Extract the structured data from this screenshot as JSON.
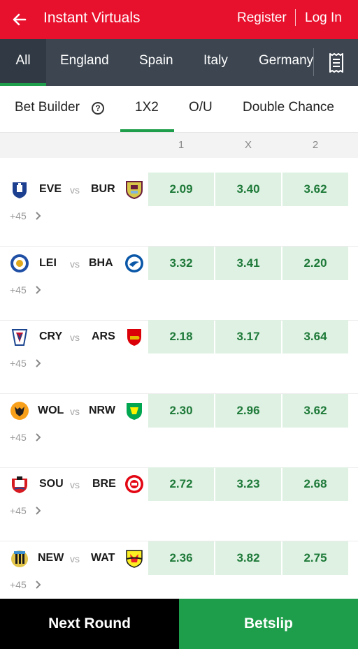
{
  "header": {
    "title": "Instant Virtuals",
    "register_label": "Register",
    "login_label": "Log In",
    "back_icon": "arrow-left-icon",
    "color": "#e8112d"
  },
  "nav": {
    "tabs": [
      "All",
      "England",
      "Spain",
      "Italy",
      "Germany"
    ],
    "active": "All",
    "betslip_icon": "receipt-icon"
  },
  "markets": {
    "bet_builder_label": "Bet Builder",
    "tabs": [
      "1X2",
      "O/U",
      "Double Chance"
    ],
    "active": "1X2"
  },
  "columns": [
    "1",
    "X",
    "2"
  ],
  "matches": [
    {
      "home": "EVE",
      "vs": "vs",
      "away": "BUR",
      "odds": [
        "2.09",
        "3.40",
        "3.62"
      ],
      "more": "+45"
    },
    {
      "home": "LEI",
      "vs": "vs",
      "away": "BHA",
      "odds": [
        "3.32",
        "3.41",
        "2.20"
      ],
      "more": "+45"
    },
    {
      "home": "CRY",
      "vs": "vs",
      "away": "ARS",
      "odds": [
        "2.18",
        "3.17",
        "3.64"
      ],
      "more": "+45"
    },
    {
      "home": "WOL",
      "vs": "vs",
      "away": "NRW",
      "odds": [
        "2.30",
        "2.96",
        "3.62"
      ],
      "more": "+45"
    },
    {
      "home": "SOU",
      "vs": "vs",
      "away": "BRE",
      "odds": [
        "2.72",
        "3.23",
        "2.68"
      ],
      "more": "+45"
    },
    {
      "home": "NEW",
      "vs": "vs",
      "away": "WAT",
      "odds": [
        "2.36",
        "3.82",
        "2.75"
      ],
      "more": "+45"
    }
  ],
  "footer": {
    "next_round_label": "Next Round",
    "betslip_label": "Betslip"
  },
  "colors": {
    "accent_green": "#1e9e4a",
    "odds_bg": "#def1e2",
    "odds_text": "#1f7a3a",
    "nav_bg": "#3c4550"
  }
}
